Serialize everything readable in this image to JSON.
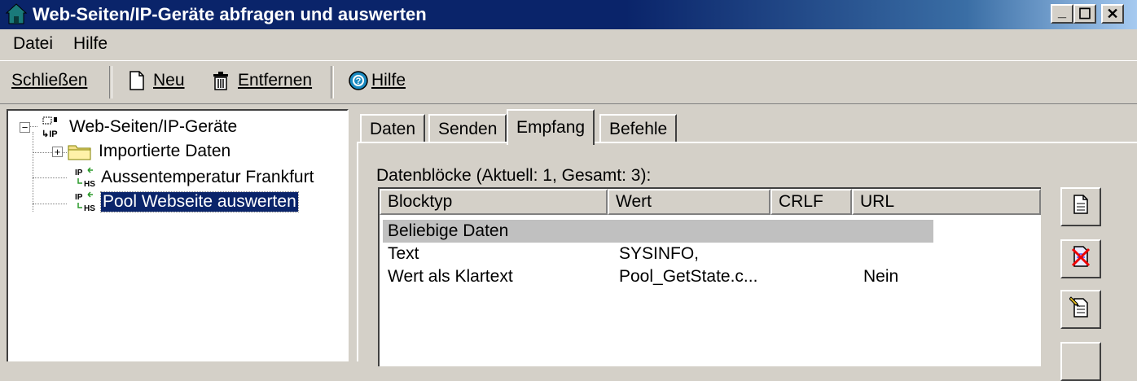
{
  "window": {
    "title": "Web-Seiten/IP-Geräte abfragen und auswerten",
    "minimize_glyph": "_",
    "maximize_glyph": "☐",
    "close_glyph": "✕"
  },
  "menu": {
    "items": [
      {
        "label": "Datei"
      },
      {
        "label": "Hilfe"
      }
    ]
  },
  "toolbar": {
    "close_label": "Schließen",
    "new_label": "Neu",
    "remove_label": "Entfernen",
    "help_label": "Hilfe"
  },
  "tree": {
    "root_label": "Web-Seiten/IP-Geräte",
    "items": [
      {
        "label": "Importierte Daten",
        "icon": "folder-icon"
      },
      {
        "label": "Aussentemperatur Frankfurt",
        "icon": "ip-hs-icon"
      },
      {
        "label": "Pool Webseite auswerten",
        "icon": "ip-hs-icon",
        "selected": true
      }
    ]
  },
  "tabs": [
    {
      "label": "Daten"
    },
    {
      "label": "Senden"
    },
    {
      "label": "Empfang",
      "active": true
    },
    {
      "label": "Befehle"
    }
  ],
  "datablocks": {
    "caption": "Datenblöcke (Aktuell: 1, Gesamt: 3):",
    "columns": [
      "Blocktyp",
      "Wert",
      "CRLF",
      "URL"
    ],
    "rows": [
      {
        "blocktyp": "Beliebige Daten",
        "wert": "",
        "crlf": "",
        "url": "",
        "highlighted": true
      },
      {
        "blocktyp": "Text",
        "wert": "SYSINFO,",
        "crlf": "",
        "url": ""
      },
      {
        "blocktyp": "Wert als Klartext",
        "wert": "Pool_GetState.c...",
        "crlf": "",
        "url": "Nein"
      }
    ]
  },
  "colors": {
    "titlebar": "#0a246a",
    "face": "#d4d0c8",
    "selection": "#0a246a",
    "row_highlight": "#c0c0c0"
  }
}
